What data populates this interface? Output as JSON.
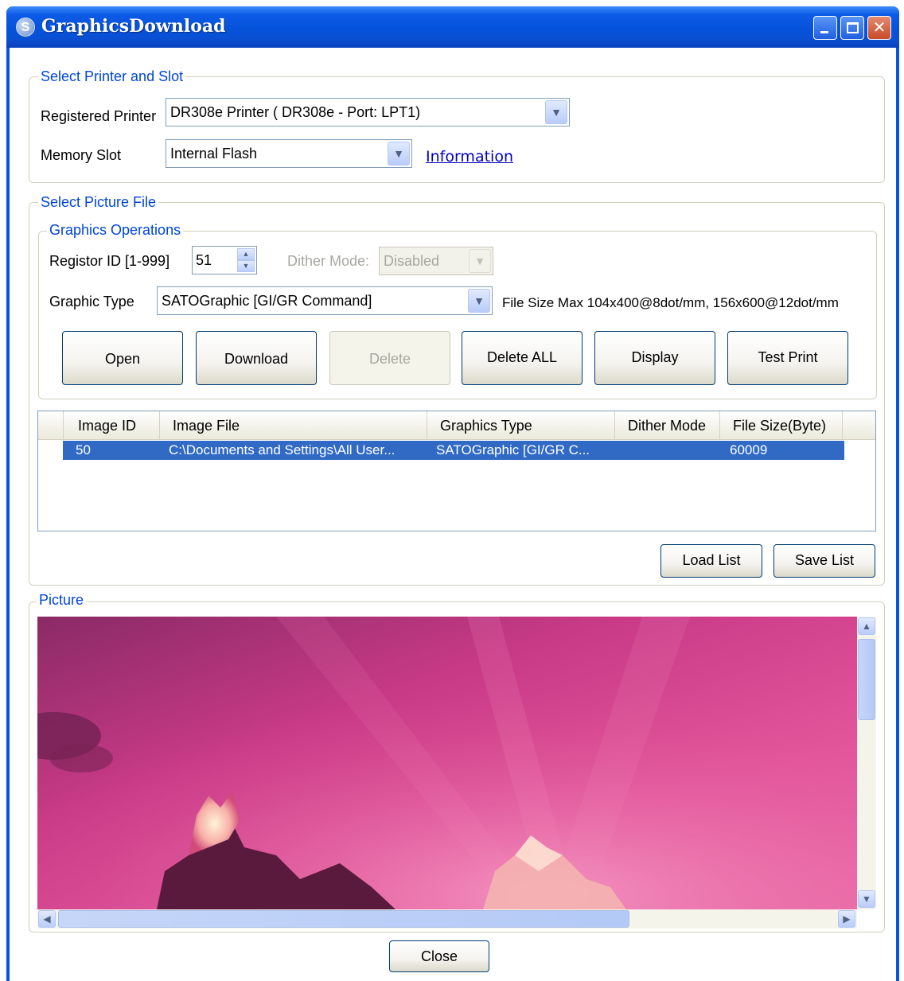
{
  "window": {
    "title": "GraphicsDownload",
    "icon": "sato-app-icon"
  },
  "printer_group": {
    "legend": "Select Printer and Slot",
    "registered_printer_label": "Registered Printer",
    "registered_printer_value": "DR308e Printer ( DR308e - Port: LPT1)",
    "memory_slot_label": "Memory Slot",
    "memory_slot_value": "Internal Flash",
    "information_link": "Information"
  },
  "picture_file_group": {
    "legend": "Select Picture File",
    "operations": {
      "legend": "Graphics Operations",
      "registor_id_label": "Registor ID [1-999]",
      "registor_id_value": "51",
      "dither_mode_label": "Dither Mode:",
      "dither_mode_value": "Disabled",
      "graphic_type_label": "Graphic Type",
      "graphic_type_value": "SATOGraphic [GI/GR Command]",
      "file_size_note": "File Size Max 104x400@8dot/mm, 156x600@12dot/mm",
      "buttons": {
        "open": "Open",
        "download": "Download",
        "delete": "Delete",
        "delete_all": "Delete ALL",
        "display": "Display",
        "test_print": "Test Print"
      }
    },
    "table": {
      "columns": [
        "Image ID",
        "Image File",
        "Graphics Type",
        "Dither Mode",
        "File Size(Byte)"
      ],
      "rows": [
        [
          "50",
          "C:\\Documents and Settings\\All User...",
          "SATOGraphic [GI/GR C...",
          "",
          "60009"
        ]
      ]
    },
    "load_list": "Load List",
    "save_list": "Save List"
  },
  "picture_group": {
    "legend": "Picture",
    "image": "pink-sky-sunset-clouds-photo"
  },
  "close_button": "Close",
  "colors": {
    "title_bar": "#0a53df",
    "legend_text": "#0046d5",
    "selection": "#316ac5"
  }
}
